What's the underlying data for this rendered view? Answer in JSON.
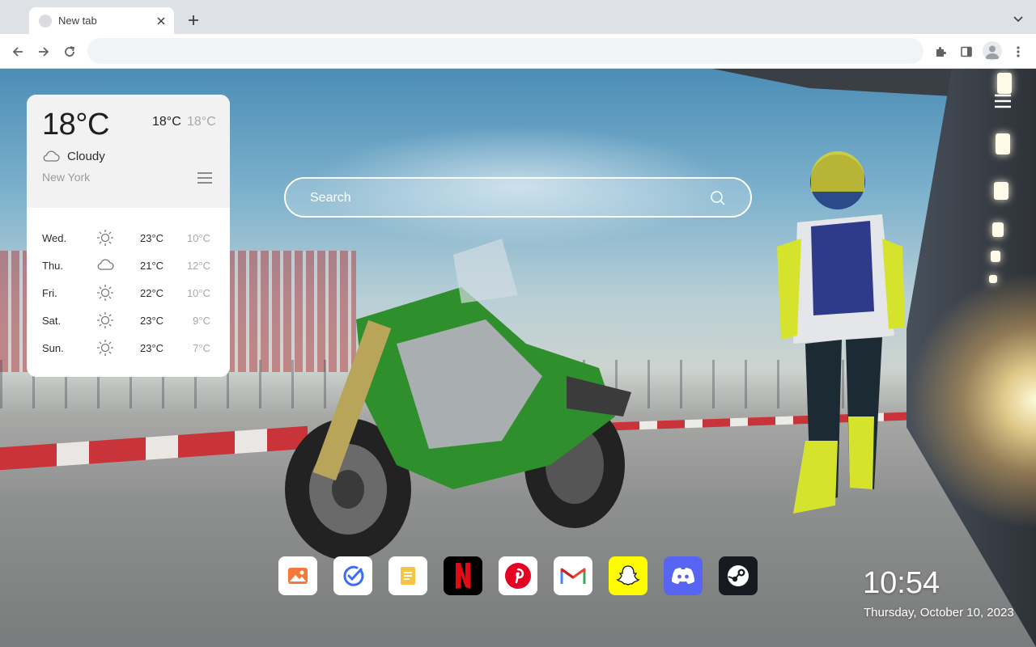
{
  "browser": {
    "tab_title": "New tab",
    "omnibox_value": "",
    "omnibox_placeholder": ""
  },
  "weather": {
    "current_temp": "18°C",
    "high": "18°C",
    "low": "18°C",
    "condition": "Cloudy",
    "condition_icon": "cloud-icon",
    "city": "New York",
    "forecast": [
      {
        "day": "Wed.",
        "icon": "sun-icon",
        "high": "23°C",
        "low": "10°C"
      },
      {
        "day": "Thu.",
        "icon": "cloud-icon",
        "high": "21°C",
        "low": "12°C"
      },
      {
        "day": "Fri.",
        "icon": "sun-icon",
        "high": "22°C",
        "low": "10°C"
      },
      {
        "day": "Sat.",
        "icon": "sun-icon",
        "high": "23°C",
        "low": "9°C"
      },
      {
        "day": "Sun.",
        "icon": "sun-icon",
        "high": "23°C",
        "low": "7°C"
      }
    ]
  },
  "search": {
    "placeholder": "Search"
  },
  "dock": [
    {
      "name": "gallery-app",
      "icon": "image-icon"
    },
    {
      "name": "tasks-app",
      "icon": "check-icon"
    },
    {
      "name": "notes-app",
      "icon": "note-icon"
    },
    {
      "name": "netflix-app",
      "icon": "netflix-icon"
    },
    {
      "name": "pinterest-app",
      "icon": "pinterest-icon"
    },
    {
      "name": "gmail-app",
      "icon": "gmail-icon"
    },
    {
      "name": "snapchat-app",
      "icon": "snapchat-icon"
    },
    {
      "name": "discord-app",
      "icon": "discord-icon"
    },
    {
      "name": "steam-app",
      "icon": "steam-icon"
    }
  ],
  "clock": {
    "time": "10:54",
    "date": "Thursday, October 10, 2023"
  },
  "colors": {
    "netflix": "#e50914",
    "pinterest": "#e60023",
    "snapchat": "#fffc00",
    "discord": "#5865f2",
    "steam": "#171a21"
  }
}
